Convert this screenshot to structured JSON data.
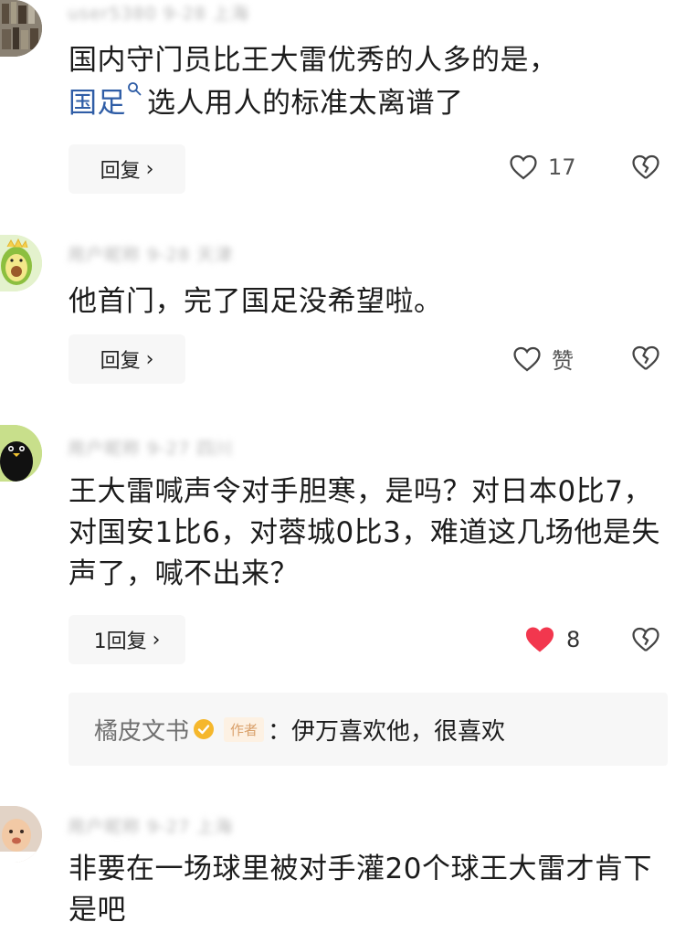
{
  "comments": [
    {
      "meta": "user5380 9-28 上海",
      "text_before": "国内守门员比王大雷优秀的人多的是，",
      "link": "国足",
      "text_after": "选人用人的标准太离谱了",
      "reply_label": "回复",
      "likes": "17",
      "liked": false,
      "avatar": "bookshelf-avatar"
    },
    {
      "meta": "用户昵称 9-28 天津",
      "text": "他首门，完了国足没希望啦。",
      "reply_label": "回复",
      "likes": "赞",
      "liked": false,
      "avatar": "avocado-avatar"
    },
    {
      "meta": "用户昵称 9-27 四川",
      "text": "王大雷喊声令对手胆寒，是吗？对日本0比7，对国安1比6，对蓉城0比3，难道这几场他是失声了，喊不出来？",
      "reply_label": "1回复",
      "likes": "8",
      "liked": true,
      "avatar": "bird-avatar",
      "author_reply": {
        "name": "橘皮文书",
        "tag": "作者",
        "text": "：伊万喜欢他，很喜欢"
      }
    },
    {
      "meta": "用户昵称 9-27 上海",
      "text": "非要在一场球里被对手灌20个球王大雷才肯下 是吧",
      "avatar": "baby-avatar"
    }
  ],
  "colors": {
    "liked_heart": "#f2374e",
    "link": "#2f5da6",
    "author_tag_bg": "#fdf1e3",
    "author_tag_text": "#d9a06a"
  },
  "icons": {
    "like": "heart-outline-icon",
    "liked": "heart-filled-icon",
    "dislike": "broken-heart-icon",
    "link": "search-icon",
    "verified": "verified-badge-icon",
    "reply": "chevron-right-icon"
  }
}
